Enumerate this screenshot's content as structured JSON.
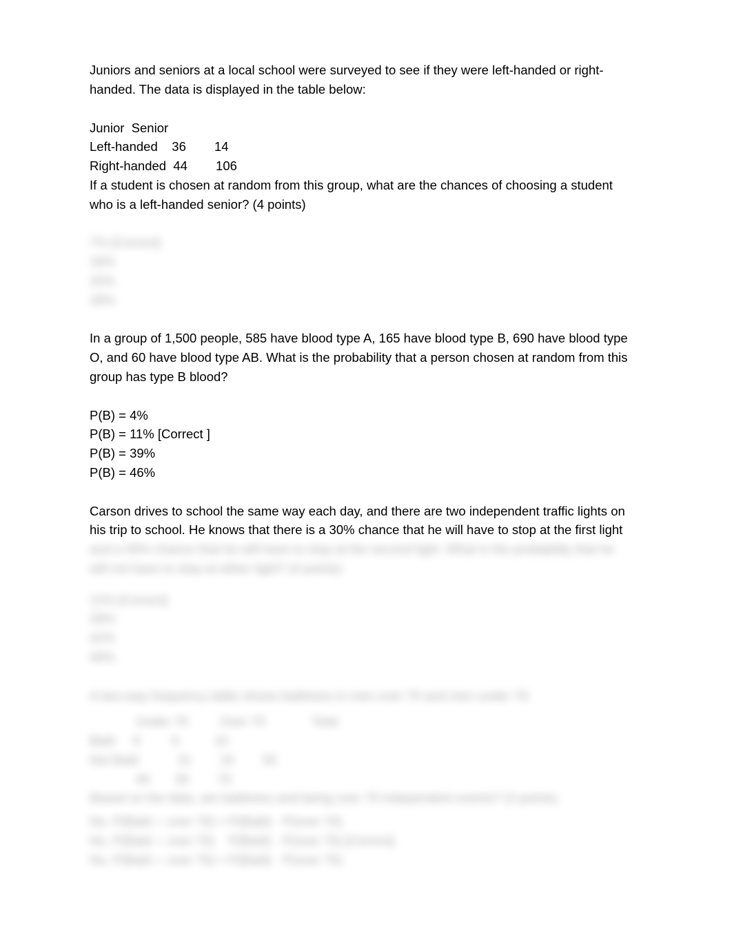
{
  "q1": {
    "intro_l1": "Juniors and seniors at a local school were surveyed to see if they were left-handed or right-",
    "intro_l2": "handed. The data is displayed in the table below:",
    "table_headers": "Junior  Senior",
    "row_left": "Left-handed    36        14",
    "row_right": "Right-handed  44        106",
    "prompt_l1": "If a student is chosen at random from this group, what are the chances of choosing a student",
    "prompt_l2": "who is a left-handed senior? (4 points)",
    "ans_l1": "7% [Correct]",
    "ans_l2": "18%",
    "ans_l3": "25%",
    "ans_l4": "28%"
  },
  "q2": {
    "intro_l1": "In a group of 1,500 people, 585 have blood type A, 165 have blood type B, 690 have blood type",
    "intro_l2": "O, and 60 have blood type AB. What is the probability that a person chosen at random from this",
    "intro_l3": "group has type B blood?",
    "opt1": "P(B) = 4%",
    "opt2": "P(B) = 11% [Correct ]",
    "opt3": "P(B) = 39%",
    "opt4": "P(B) = 46%"
  },
  "q3": {
    "intro_l1": "Carson drives to school the same way each day, and there are two independent traffic lights on",
    "intro_l2": "his trip to school. He knows that there is a 30% chance that he will have to stop at the first light",
    "intro_l3": "and a 40% chance that he will have to stop at the second light. What is the probability that he",
    "intro_l4": "will not have to stop at either light? (4 points)",
    "ans_l1": "12% [Correct]",
    "ans_l2": "28%",
    "ans_l3": "42%",
    "ans_l4": "58%"
  },
  "q4": {
    "intro_l1": "A two-way frequency table shows baldness in men over 70 and men under 70:",
    "table_l1": "             Under 70         Over 70             Total",
    "table_l2": "Bald     9         6          15",
    "table_l3": "Not Bald           31        24        55",
    "table_l4": "             40       30        70",
    "prompt_l1": "Based on the data, are baldness and being over 70 independent events? (2 points)",
    "ans_l1": "No, P(Bald ∩ over 70) = P(Bald) · P(over 70)",
    "ans_l2": "No, P(Bald ∩ over 70)    P(Bald) · P(over 70) [Correct]",
    "ans_l3": "No, P(Bald ∩ over 70) > P(Bald) · P(over 70)"
  }
}
